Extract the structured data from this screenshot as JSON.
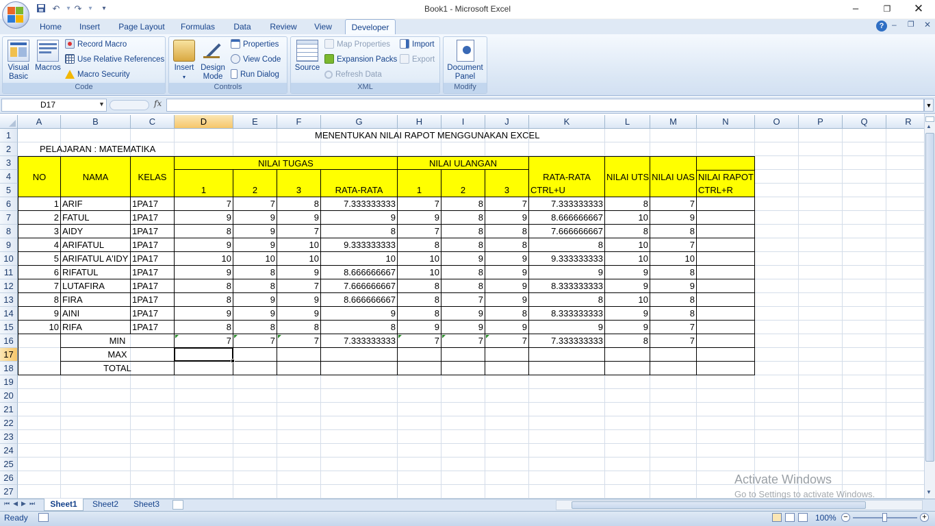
{
  "window": {
    "title": "Book1 - Microsoft Excel"
  },
  "qat": {
    "save": "save-icon",
    "undo": "undo-icon",
    "redo": "redo-icon",
    "customize": "▾"
  },
  "tabs": [
    "Home",
    "Insert",
    "Page Layout",
    "Formulas",
    "Data",
    "Review",
    "View",
    "Developer"
  ],
  "active_tab": "Developer",
  "ribbon": {
    "code": {
      "label": "Code",
      "visual_basic": "Visual Basic",
      "visual_basic_l1": "Visual",
      "visual_basic_l2": "Basic",
      "macros": "Macros",
      "record_macro": "Record Macro",
      "relative_refs": "Use Relative References",
      "macro_security": "Macro Security"
    },
    "controls": {
      "label": "Controls",
      "insert": "Insert",
      "design_l1": "Design",
      "design_l2": "Mode",
      "properties": "Properties",
      "view_code": "View Code",
      "run_dialog": "Run Dialog"
    },
    "xml": {
      "label": "XML",
      "source": "Source",
      "map_properties": "Map Properties",
      "expansion_packs": "Expansion Packs",
      "refresh_data": "Refresh Data",
      "import": "Import",
      "export": "Export"
    },
    "modify": {
      "label": "Modify",
      "doc_l1": "Document",
      "doc_l2": "Panel"
    }
  },
  "formula_bar": {
    "name_box": "D17",
    "fx": "fx",
    "value": ""
  },
  "columns": [
    "A",
    "B",
    "C",
    "D",
    "E",
    "F",
    "G",
    "H",
    "I",
    "J",
    "K",
    "L",
    "M",
    "N",
    "O",
    "P",
    "Q",
    "R"
  ],
  "selected_column": "D",
  "rows": [
    "1",
    "2",
    "3",
    "4",
    "5",
    "6",
    "7",
    "8",
    "9",
    "10",
    "11",
    "12",
    "13",
    "14",
    "15",
    "16",
    "17",
    "18",
    "19",
    "20",
    "21",
    "22",
    "23",
    "24",
    "25",
    "26",
    "27"
  ],
  "selected_row": "17",
  "sheet": {
    "title": "MENENTUKAN NILAI RAPOT MENGGUNAKAN EXCEL",
    "subject": "PELAJARAN : MATEMATIKA",
    "headers": {
      "no": "NO",
      "nama": "NAMA",
      "kelas": "KELAS",
      "nilai_tugas": "NILAI TUGAS",
      "nilai_ulangan": "NILAI ULANGAN",
      "rata_rata": "RATA-RATA",
      "nilai_uts": "NILAI UTS",
      "nilai_uas": "NILAI UAS",
      "nilai_rapot": "NILAI RAPOT",
      "t1": "1",
      "t2": "2",
      "t3": "3",
      "t_avg": "RATA-RATA",
      "u1": "1",
      "u2": "2",
      "u3": "3",
      "ctrl_u": "CTRL+U",
      "ctrl_r": "CTRL+R"
    },
    "students": [
      [
        "1",
        "ARIF",
        "1PA17",
        "7",
        "7",
        "8",
        "7.333333333",
        "7",
        "8",
        "7",
        "7.333333333",
        "8",
        "7"
      ],
      [
        "2",
        "FATUL",
        "1PA17",
        "9",
        "9",
        "9",
        "9",
        "9",
        "8",
        "9",
        "8.666666667",
        "10",
        "9"
      ],
      [
        "3",
        "AIDY",
        "1PA17",
        "8",
        "9",
        "7",
        "8",
        "7",
        "8",
        "8",
        "7.666666667",
        "8",
        "8"
      ],
      [
        "4",
        "ARIFATUL",
        "1PA17",
        "9",
        "9",
        "10",
        "9.333333333",
        "8",
        "8",
        "8",
        "8",
        "10",
        "7"
      ],
      [
        "5",
        "ARIFATUL A'IDY",
        "1PA17",
        "10",
        "10",
        "10",
        "10",
        "10",
        "9",
        "9",
        "9.333333333",
        "10",
        "10"
      ],
      [
        "6",
        "RIFATUL",
        "1PA17",
        "9",
        "8",
        "9",
        "8.666666667",
        "10",
        "8",
        "9",
        "9",
        "9",
        "8"
      ],
      [
        "7",
        "LUTAFIRA",
        "1PA17",
        "8",
        "8",
        "7",
        "7.666666667",
        "8",
        "8",
        "9",
        "8.333333333",
        "9",
        "9"
      ],
      [
        "8",
        "FIRA",
        "1PA17",
        "8",
        "9",
        "9",
        "8.666666667",
        "8",
        "7",
        "9",
        "8",
        "10",
        "8"
      ],
      [
        "9",
        "AINI",
        "1PA17",
        "9",
        "9",
        "9",
        "9",
        "8",
        "9",
        "8",
        "8.333333333",
        "9",
        "8"
      ],
      [
        "10",
        "RIFA",
        "1PA17",
        "8",
        "8",
        "8",
        "8",
        "9",
        "9",
        "9",
        "9",
        "9",
        "7"
      ]
    ],
    "min": {
      "label": "MIN",
      "values": [
        "7",
        "7",
        "7",
        "7.333333333",
        "7",
        "7",
        "7",
        "7.333333333",
        "8",
        "7"
      ]
    },
    "max": {
      "label": "MAX"
    },
    "total": {
      "label": "TOTAL"
    }
  },
  "sheet_tabs": [
    "Sheet1",
    "Sheet2",
    "Sheet3"
  ],
  "active_sheet": "Sheet1",
  "status": {
    "ready": "Ready",
    "zoom": "100%"
  },
  "watermark": {
    "line1": "Activate Windows",
    "line2": "Go to Settings to activate Windows."
  },
  "colors": {
    "highlight": "#ffff00",
    "ribbon_text": "#15428b"
  }
}
